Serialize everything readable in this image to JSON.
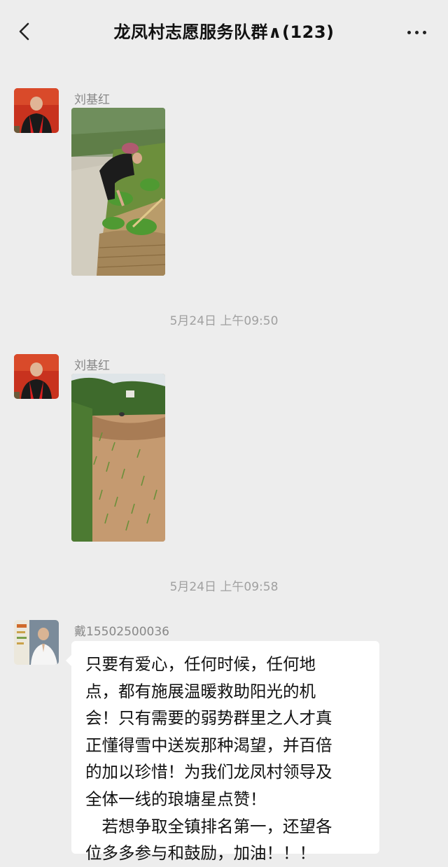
{
  "header": {
    "title": "龙凤村志愿服务队群∧(123)"
  },
  "messages": [
    {
      "sender": "刘基红",
      "type": "image",
      "time_after": "5月24日 上午09:50"
    },
    {
      "sender": "刘基红",
      "type": "image",
      "time_after": "5月24日 上午09:58"
    },
    {
      "sender": "戴15502500036",
      "type": "text",
      "text_lines": [
        "只要有爱心，任何时候，任何地",
        "点，都有施展温暖救助阳光的机",
        "会！只有需要的弱势群里之人才真",
        "正懂得雪中送炭那种渴望，并百倍",
        "的加以珍惜！为我们龙凤村领导及",
        "全体一线的琅塘星点赞！",
        "　若想争取全镇排名第一，还望各",
        "位多多参与和鼓励，加油！！！"
      ]
    }
  ],
  "icons": {
    "back": "chevron-left-icon",
    "more": "more-dots-icon"
  }
}
